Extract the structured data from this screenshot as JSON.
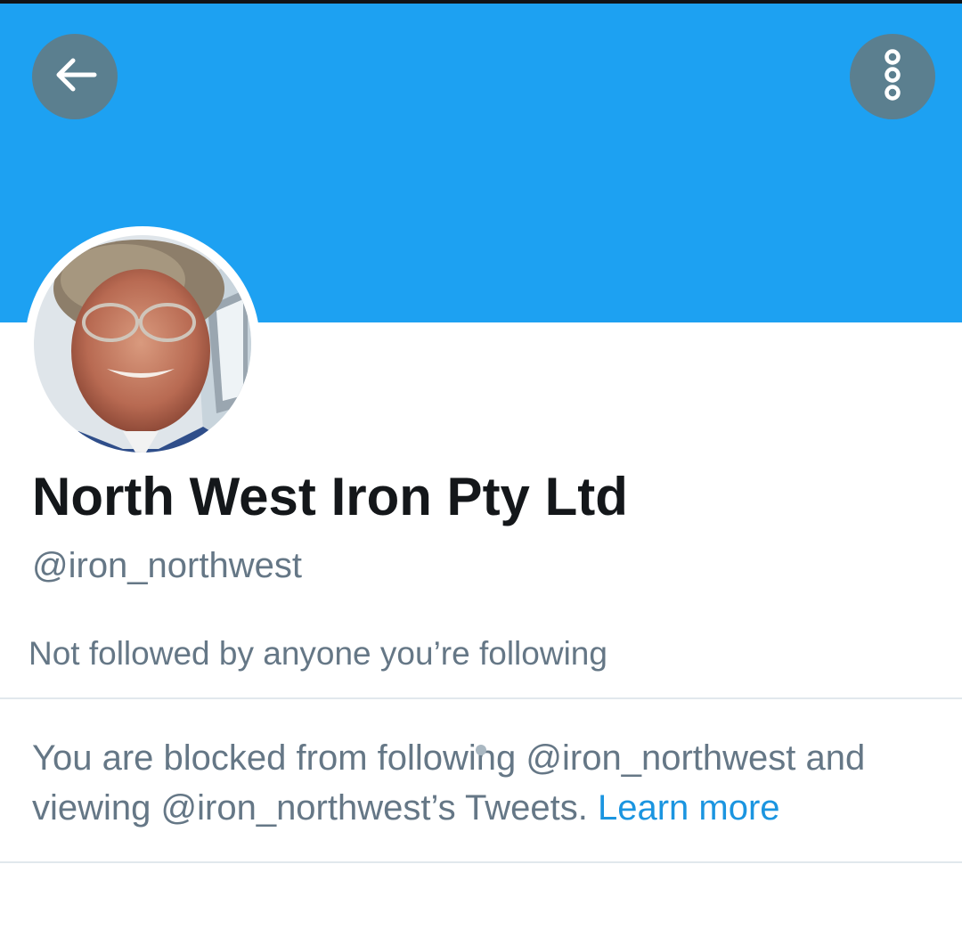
{
  "header": {
    "back_icon": "arrow-left-icon",
    "more_icon": "more-vertical-icon",
    "banner_color": "#1da1f2",
    "button_color": "#5b7f8f"
  },
  "profile": {
    "display_name": "North West Iron Pty Ltd",
    "handle": "@iron_northwest",
    "followers_note": "Not followed by anyone you’re following"
  },
  "blocked_notice": {
    "text": "You are blocked from following @iron_northwest and viewing @iron_northwest’s Tweets.",
    "link_label": "Learn more",
    "link_color": "#1b95e0"
  }
}
